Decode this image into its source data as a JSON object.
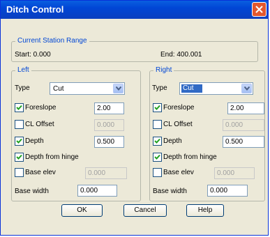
{
  "window": {
    "title": "Ditch Control"
  },
  "station_range": {
    "legend": "Current Station Range",
    "start": "Start: 0.000",
    "end": "End: 400.001"
  },
  "left": {
    "legend": "Left",
    "type_label": "Type",
    "type_value": "Cut",
    "foreslope": {
      "label": "Foreslope",
      "checked": true,
      "value": "2.00"
    },
    "cl_offset": {
      "label": "CL Offset",
      "checked": false,
      "value": "0.000"
    },
    "depth": {
      "label": "Depth",
      "checked": true,
      "value": "0.500"
    },
    "depth_from_hinge": {
      "label": "Depth from hinge",
      "checked": true
    },
    "base_elev": {
      "label": "Base elev",
      "checked": false,
      "value": "0.000"
    },
    "base_width": {
      "label": "Base width",
      "value": "0.000"
    }
  },
  "right": {
    "legend": "Right",
    "type_label": "Type",
    "type_value": "Cut",
    "foreslope": {
      "label": "Foreslope",
      "checked": true,
      "value": "2.00"
    },
    "cl_offset": {
      "label": "CL Offset",
      "checked": false,
      "value": "0.000"
    },
    "depth": {
      "label": "Depth",
      "checked": true,
      "value": "0.500"
    },
    "depth_from_hinge": {
      "label": "Depth from hinge",
      "checked": true
    },
    "base_elev": {
      "label": "Base elev",
      "checked": false,
      "value": "0.000"
    },
    "base_width": {
      "label": "Base width",
      "value": "0.000"
    }
  },
  "buttons": {
    "ok": "OK",
    "cancel": "Cancel",
    "help": "Help"
  },
  "colors": {
    "title_bar": "#0a5fe0",
    "legend_text": "#0046d5",
    "selection": "#316ac5",
    "dialog_bg": "#ece9d8"
  }
}
